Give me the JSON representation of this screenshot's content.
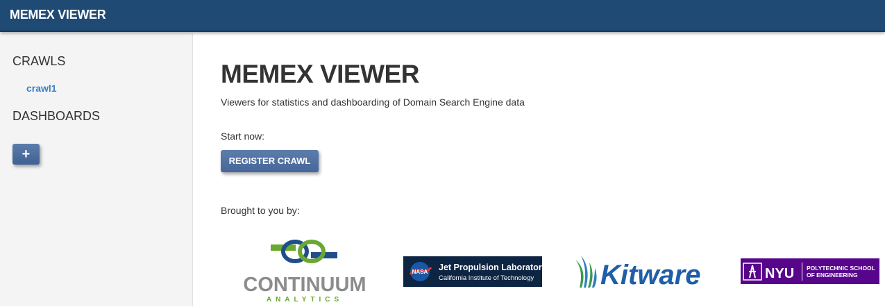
{
  "header": {
    "brand": "MEMEX VIEWER"
  },
  "sidebar": {
    "crawls_heading": "CRAWLS",
    "crawls": [
      {
        "label": "crawl1"
      }
    ],
    "dashboards_heading": "DASHBOARDS",
    "add_label": "+"
  },
  "main": {
    "title": "MEMEX VIEWER",
    "subtitle": "Viewers for statistics and dashboarding of Domain Search Engine data",
    "start_label": "Start now:",
    "register_label": "REGISTER CRAWL",
    "brought_label": "Brought to you by:"
  },
  "logos": {
    "continuum": {
      "name": "CONTINUUM",
      "sub": "ANALYTICS"
    },
    "jpl": {
      "badge": "NASA",
      "title": "Jet Propulsion Laboratory",
      "sub": "California Institute of Technology"
    },
    "kitware": {
      "name": "Kitware"
    },
    "nyu": {
      "name": "NYU",
      "line1": "POLYTECHNIC SCHOOL",
      "line2": "OF ENGINEERING"
    }
  },
  "colors": {
    "topbar": "#1f4a73",
    "button": "#4f6f9f",
    "link": "#3a7fc1",
    "nyu_purple": "#57068c",
    "jpl_navy": "#0d2443",
    "kitware_blue": "#1f5ea8",
    "continuum_green": "#6aa82f",
    "continuum_blue": "#1f4f8a"
  }
}
